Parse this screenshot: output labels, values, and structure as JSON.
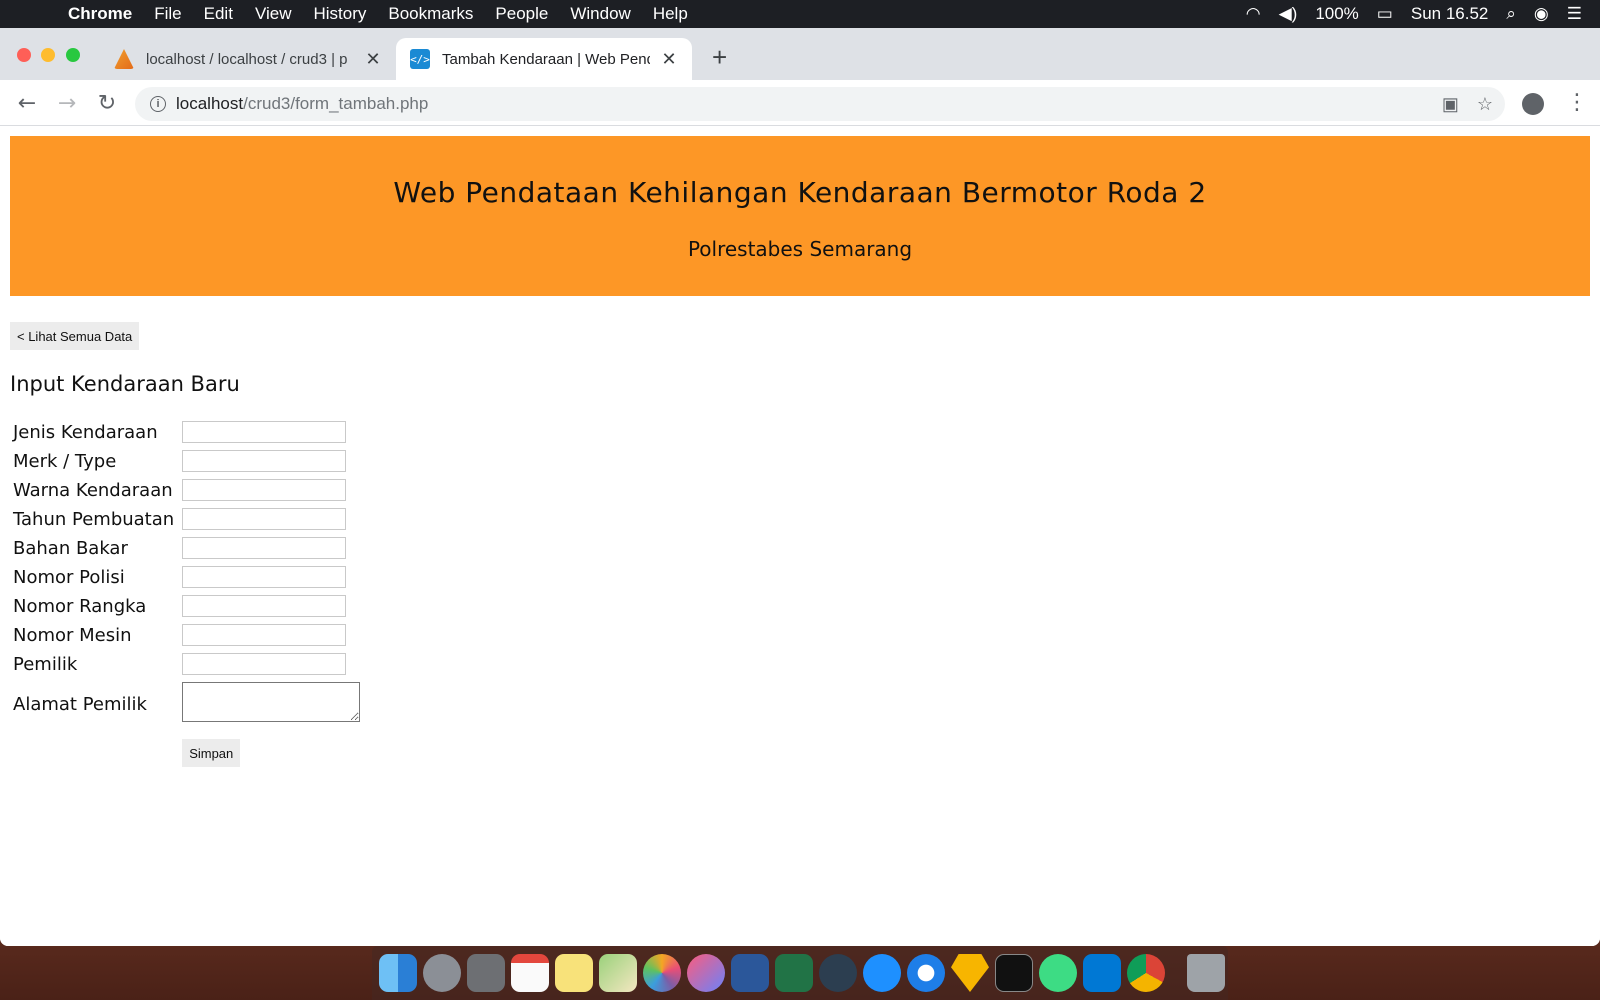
{
  "menubar": {
    "app": "Chrome",
    "items": [
      "File",
      "Edit",
      "View",
      "History",
      "Bookmarks",
      "People",
      "Window",
      "Help"
    ],
    "battery": "100%",
    "clock": "Sun 16.52"
  },
  "tabs": [
    {
      "title": "localhost / localhost / crud3 | p",
      "icon": "phpmyadmin-icon"
    },
    {
      "title": "Tambah Kendaraan | Web Pend",
      "icon": "code-icon"
    }
  ],
  "omnibox": {
    "host": "localhost",
    "path": "/crud3/form_tambah.php"
  },
  "page": {
    "header_title": "Web Pendataan Kehilangan Kendaraan Bermotor Roda 2",
    "header_subtitle": "Polrestabes Semarang",
    "back_label": "< Lihat Semua Data",
    "form_title": "Input Kendaraan Baru",
    "fields": [
      {
        "label": "Jenis Kendaraan",
        "value": ""
      },
      {
        "label": "Merk / Type",
        "value": ""
      },
      {
        "label": "Warna Kendaraan",
        "value": ""
      },
      {
        "label": "Tahun Pembuatan",
        "value": ""
      },
      {
        "label": "Bahan Bakar",
        "value": ""
      },
      {
        "label": "Nomor Polisi",
        "value": ""
      },
      {
        "label": "Nomor Rangka",
        "value": ""
      },
      {
        "label": "Nomor Mesin",
        "value": ""
      },
      {
        "label": "Pemilik",
        "value": ""
      }
    ],
    "textarea_label": "Alamat Pemilik",
    "submit_label": "Simpan"
  },
  "colors": {
    "banner": "#fd9726",
    "menubar": "#1d1f24"
  },
  "dock": [
    "finder",
    "launchpad",
    "system-preferences",
    "calendar",
    "notes",
    "maps",
    "photos",
    "itunes",
    "word",
    "excel",
    "quicktime",
    "app-store",
    "safari",
    "sketch",
    "terminal",
    "android-studio",
    "vscode",
    "chrome",
    "trash"
  ]
}
